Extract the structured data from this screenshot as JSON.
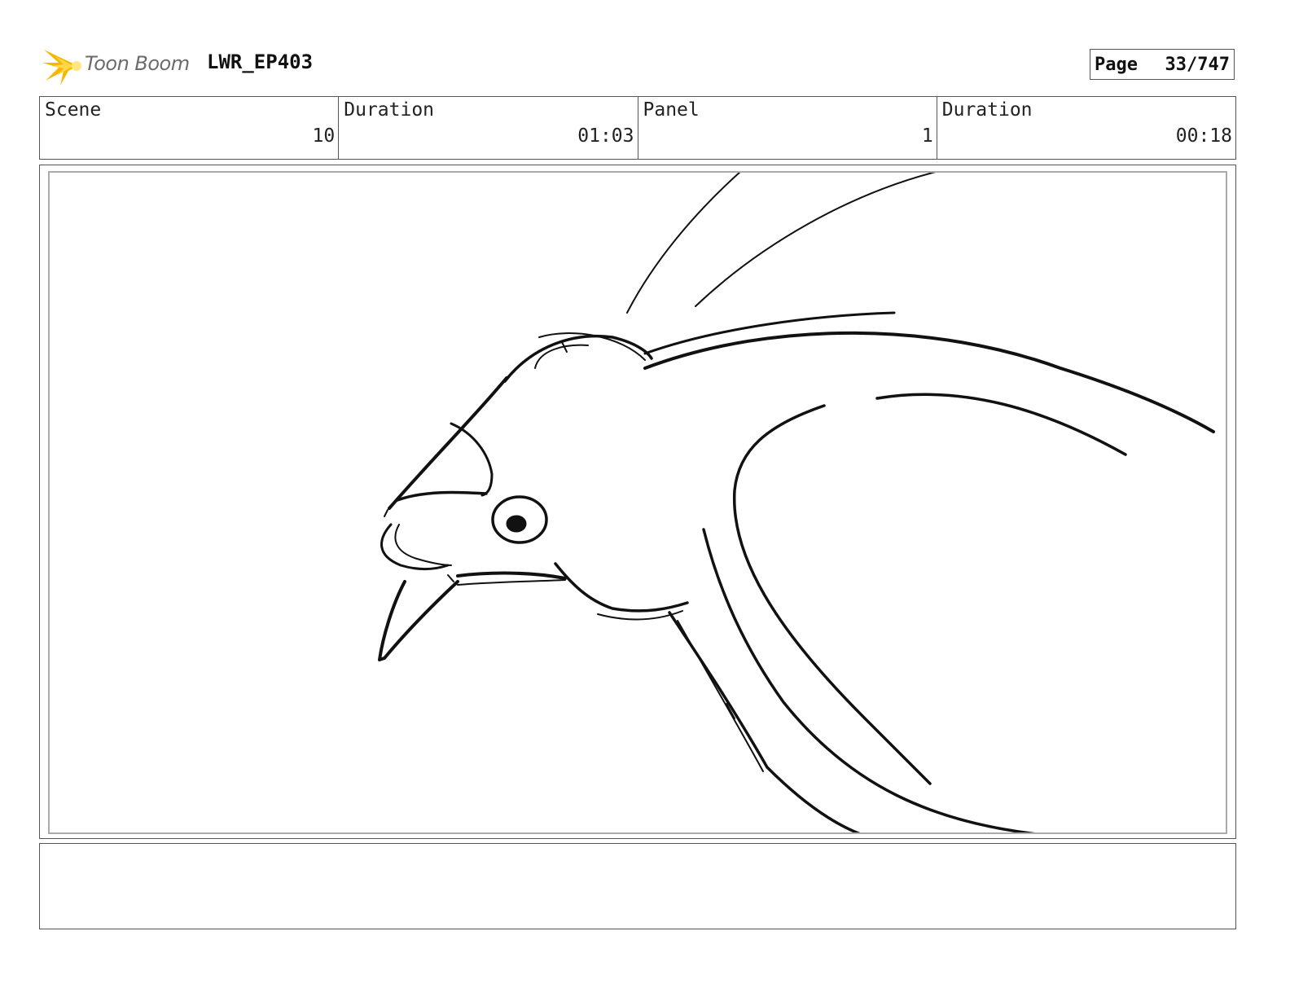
{
  "header": {
    "logo_text": "Toon Boom",
    "project_title": "LWR_EP403",
    "page_label": "Page",
    "page_number": "33/747"
  },
  "info": {
    "scene_label": "Scene",
    "scene_value": "10",
    "scene_duration_label": "Duration",
    "scene_duration_value": "01:03",
    "panel_label": "Panel",
    "panel_value": "1",
    "panel_duration_label": "Duration",
    "panel_duration_value": "00:18"
  },
  "colors": {
    "logo_star": "#f5b800",
    "logo_text": "#6b6b6b",
    "border": "#555555"
  },
  "icons": {
    "logo": "starburst-icon"
  }
}
